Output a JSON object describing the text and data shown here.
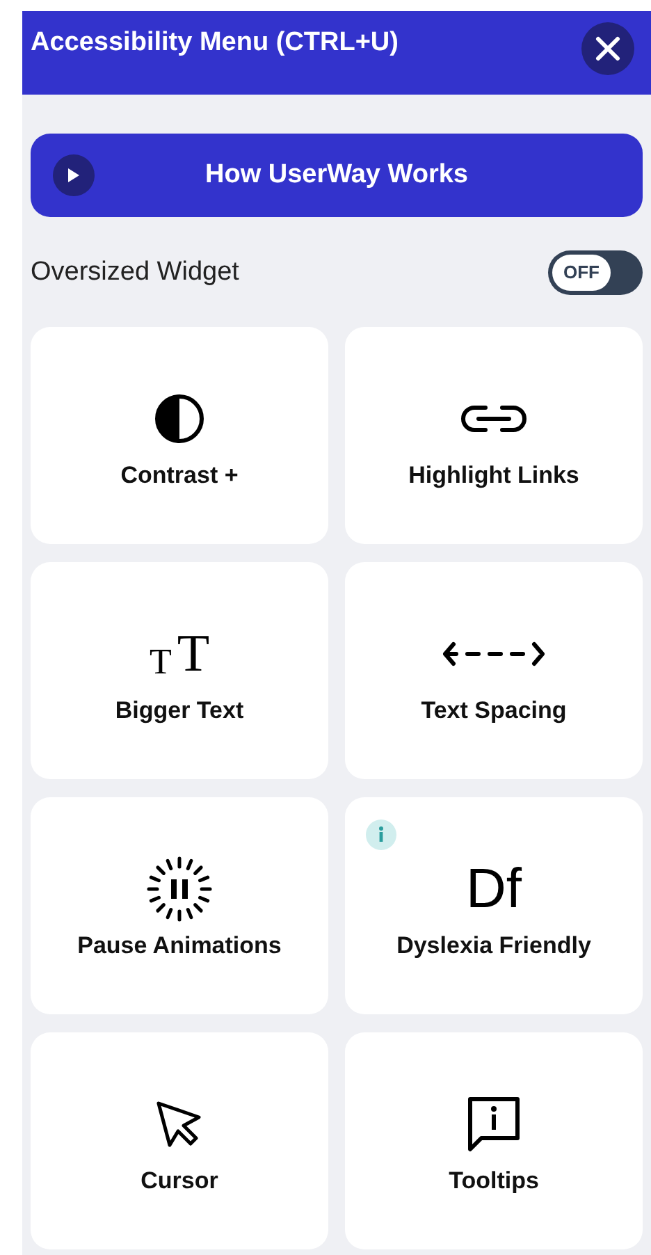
{
  "header": {
    "title": "Accessibility Menu (CTRL+U)"
  },
  "video_button": {
    "label": "How UserWay Works"
  },
  "oversized_widget": {
    "label": "Oversized Widget",
    "on": false,
    "toggle_text": "OFF"
  },
  "tile_rows": [
    {
      "tiles": [
        {
          "label": "Contrast +",
          "kind": "contrast",
          "info": false
        },
        {
          "label": "Highlight Links",
          "kind": "link",
          "info": false
        }
      ]
    },
    {
      "tiles": [
        {
          "label": "Bigger Text",
          "kind": "glyphs",
          "glyphs": [
            "T",
            "T"
          ],
          "info": false
        },
        {
          "label": "Text Spacing",
          "kind": "spacing",
          "info": false
        }
      ]
    },
    {
      "tiles": [
        {
          "label": "Pause Animations",
          "kind": "pause",
          "info": false
        },
        {
          "label": "Dyslexia Friendly",
          "kind": "glyphs",
          "glyphs": [
            "Df"
          ],
          "info": true
        }
      ]
    },
    {
      "tiles": [
        {
          "label": "Cursor",
          "kind": "cursor",
          "info": false
        },
        {
          "label": "Tooltips",
          "kind": "tooltip",
          "info": false
        }
      ]
    }
  ]
}
